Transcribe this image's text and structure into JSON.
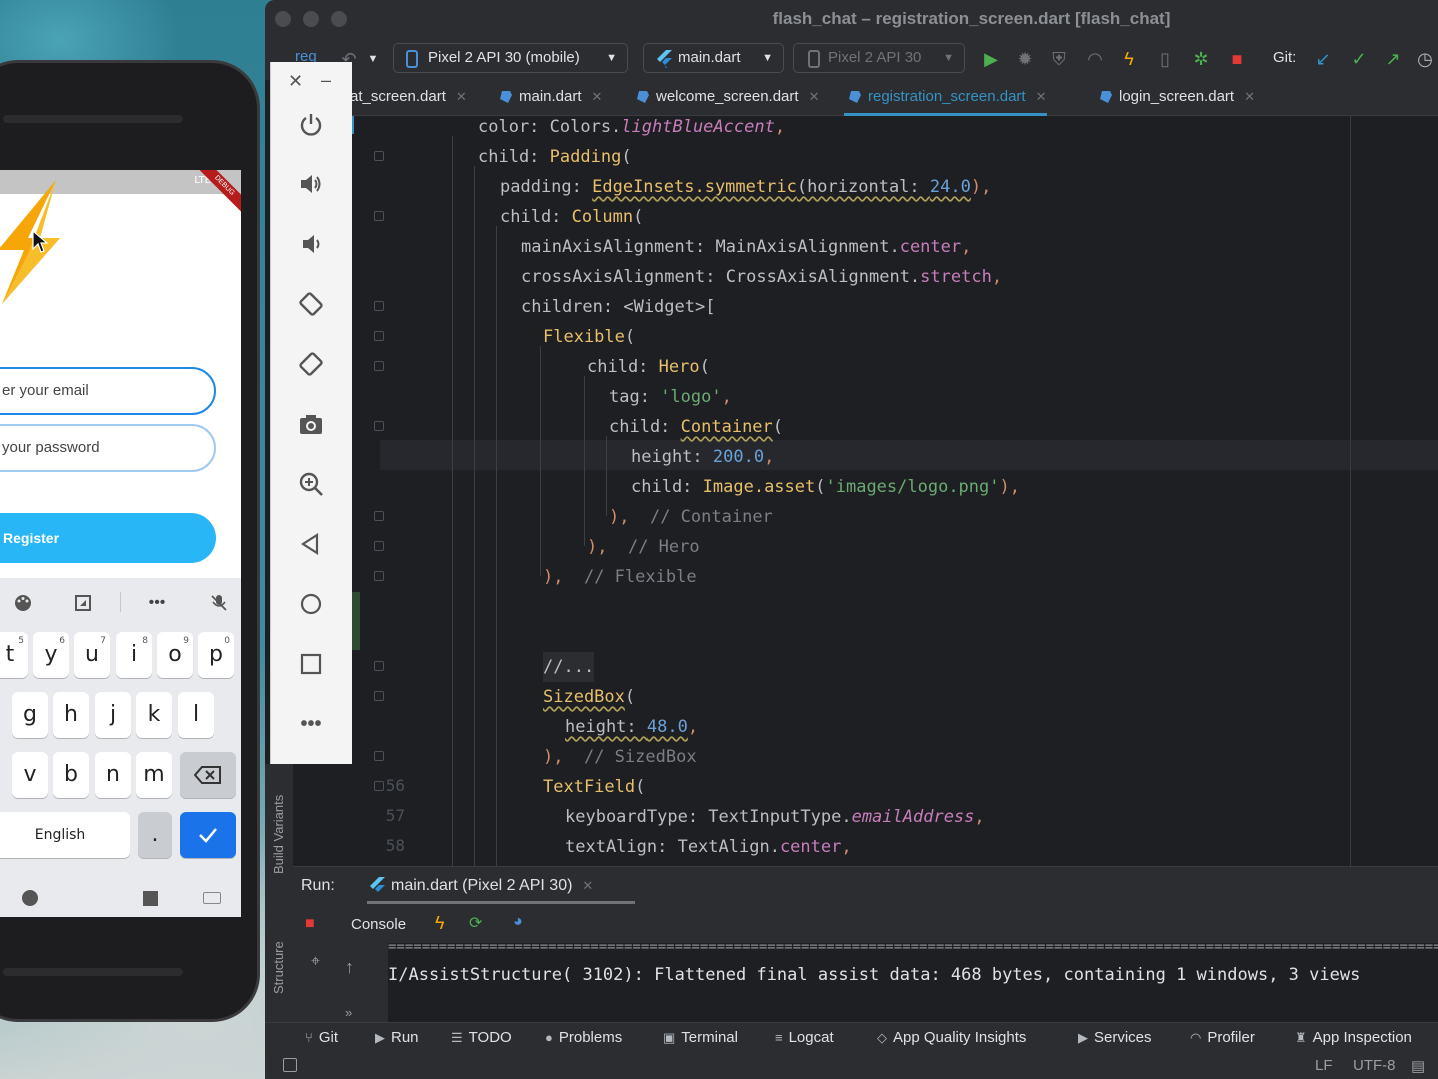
{
  "window": {
    "title": "flash_chat – registration_screen.dart [flash_chat]"
  },
  "toolbar": {
    "project_label": "reg",
    "device_combo": "Pixel 2 API 30 (mobile)",
    "run_config_combo": "main.dart",
    "device_combo_2": "Pixel 2 API 30",
    "git_label": "Git:"
  },
  "tabs": [
    {
      "label": "at_screen.dart"
    },
    {
      "label": "main.dart"
    },
    {
      "label": "welcome_screen.dart"
    },
    {
      "label": "registration_screen.dart"
    },
    {
      "label": "login_screen.dart"
    }
  ],
  "gutter_numbers": [
    "56",
    "57",
    "58"
  ],
  "code": {
    "l1_a": "color: Colors.",
    "l1_b": "lightBlueAccent",
    "l1_c": ",",
    "l2_a": "child: ",
    "l2_b": "Padding",
    "l2_c": "(",
    "l3_a": "padding: ",
    "l3_b": "EdgeInsets.symmetric",
    "l3_c": "(horizontal: ",
    "l3_d": "24.0",
    "l3_e": "),",
    "l4_a": "child: ",
    "l4_b": "Column",
    "l4_c": "(",
    "l5_a": "mainAxisAlignment: MainAxisAlignment.",
    "l5_b": "center",
    "l5_c": ",",
    "l6_a": "crossAxisAlignment: CrossAxisAlignment.",
    "l6_b": "stretch",
    "l6_c": ",",
    "l7": "children: <Widget>[",
    "l8_a": "Flexible",
    "l8_b": "(",
    "l9_a": "child: ",
    "l9_b": "Hero",
    "l9_c": "(",
    "l10_a": "tag: ",
    "l10_b": "'logo'",
    "l10_c": ",",
    "l11_a": "child: ",
    "l11_b": "Container",
    "l11_c": "(",
    "l12_a": "height: ",
    "l12_b": "200.0",
    "l12_c": ",",
    "l13_a": "child: ",
    "l13_b": "Image.asset",
    "l13_c": "(",
    "l13_d": "'images/logo.png'",
    "l13_e": "),",
    "l14_a": "),",
    "l14_b": "// Container",
    "l15_a": "),",
    "l15_b": "// Hero",
    "l16_a": "),",
    "l16_b": "// Flexible",
    "l17": "//...",
    "l18_a": "SizedBox",
    "l18_b": "(",
    "l19_a": "height: ",
    "l19_b": "48.0",
    "l19_c": ",",
    "l20_a": "),",
    "l20_b": "// SizedBox",
    "l21_a": "TextField",
    "l21_b": "(",
    "l22_a": "keyboardType: TextInputType.",
    "l22_b": "emailAddress",
    "l22_c": ",",
    "l23_a": "textAlign: TextAlign.",
    "l23_b": "center",
    "l23_c": ","
  },
  "side_panel": {
    "build_variants": "Build Variants",
    "structure": "Structure"
  },
  "run_panel": {
    "run_label": "Run:",
    "run_tab": "main.dart (Pixel 2 API 30)",
    "console_label": "Console",
    "separator": "================================================================================================================================",
    "console_line": "I/AssistStructure( 3102): Flattened final assist data: 468 bytes, containing 1 windows, 3 views"
  },
  "bottom_bar": {
    "git": "Git",
    "run": "Run",
    "todo": "TODO",
    "problems": "Problems",
    "terminal": "Terminal",
    "logcat": "Logcat",
    "aqi": "App Quality Insights",
    "services": "Services",
    "profiler": "Profiler",
    "inspection": "App Inspection"
  },
  "status_line": {
    "lf": "LF",
    "encoding": "UTF-8"
  },
  "phone": {
    "status_text": "LTE",
    "debug_ribbon": "DEBUG",
    "email_field": "er your email",
    "password_field": "your password",
    "register_button": "Register",
    "keyboard_row1": [
      {
        "key": "t",
        "num": "5"
      },
      {
        "key": "y",
        "num": "6"
      },
      {
        "key": "u",
        "num": "7"
      },
      {
        "key": "i",
        "num": "8"
      },
      {
        "key": "o",
        "num": "9"
      },
      {
        "key": "p",
        "num": "0"
      }
    ],
    "keyboard_row2": [
      "g",
      "h",
      "j",
      "k",
      "l"
    ],
    "keyboard_row3": [
      "v",
      "b",
      "n",
      "m"
    ],
    "space_label": "English",
    "period_key": "."
  },
  "colors": {
    "accent": "#3592c4",
    "register_button": "#29b6f6",
    "run_green": "#4caf50",
    "stop_red": "#e53935"
  }
}
